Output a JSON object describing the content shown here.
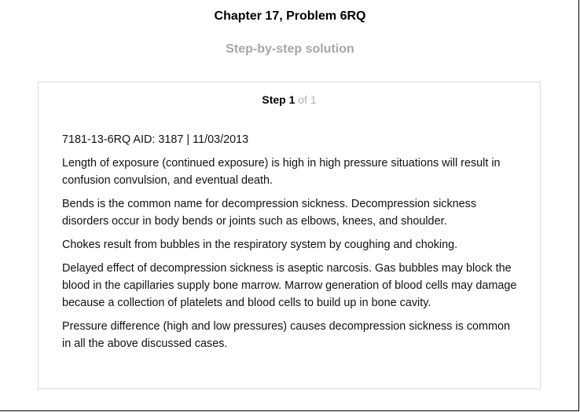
{
  "header": {
    "chapter_title": "Chapter 17, Problem 6RQ",
    "subtitle": "Step-by-step solution"
  },
  "step": {
    "label": "Step",
    "number": "1",
    "of_text": "of 1",
    "paragraphs": [
      "7181-13-6RQ AID: 3187 | 11/03/2013",
      "Length of exposure (continued exposure) is high in high pressure situations will result in confusion convulsion, and eventual death.",
      "Bends is the common name for decompression sickness. Decompression sickness disorders occur in body bends or joints such as elbows, knees, and shoulder.",
      "Chokes result from bubbles in the respiratory system by coughing and choking.",
      "Delayed effect of decompression sickness is aseptic narcosis. Gas bubbles may block the blood in the capillaries supply bone marrow. Marrow generation of blood cells may damage because a collection of platelets and blood cells to build up in bone cavity.",
      "Pressure difference (high and low pressures) causes decompression sickness is common in all the above discussed cases."
    ]
  },
  "colors": {
    "subtitle_gray": "#a6a6a6",
    "card_border": "#dcdcdc",
    "step_of_gray": "#b0b0b0"
  }
}
